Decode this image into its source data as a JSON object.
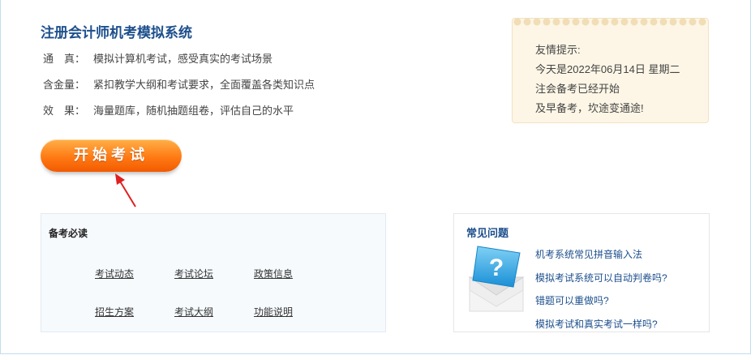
{
  "header": {
    "title": "注册会计师机考模拟系统"
  },
  "features": [
    {
      "label": "通　真：",
      "text": "模拟计算机考试，感受真实的考试场景"
    },
    {
      "label": "含金量：",
      "text": "紧扣教学大纲和考试要求，全面覆盖各类知识点"
    },
    {
      "label": "效　果：",
      "text": "海量题库，随机抽题组卷，评估自己的水平"
    }
  ],
  "start_button": {
    "label": "开始考试"
  },
  "tip": {
    "lines": [
      "友情提示:",
      "今天是2022年06月14日 星期二",
      "注会备考已经开始",
      "及早备考，坎途变通途!"
    ]
  },
  "must_read": {
    "title": "备考必读",
    "links": [
      "考试动态",
      "考试论坛",
      "政策信息",
      "招生方案",
      "考试大纲",
      "功能说明"
    ]
  },
  "faq": {
    "title": "常见问题",
    "icon": "question-box-icon",
    "items": [
      "机考系统常见拼音输入法",
      "模拟考试系统可以自动判卷吗?",
      "错题可以重做吗?",
      "模拟考试和真实考试一样吗?"
    ]
  },
  "colors": {
    "title_blue": "#1d4f8c",
    "button_orange": "#ff7a14",
    "tip_bg": "#fdf6e6",
    "arrow_red": "#e02020"
  }
}
